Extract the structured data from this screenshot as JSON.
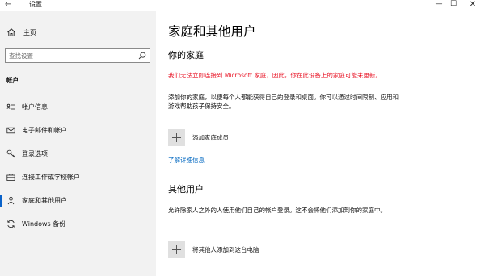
{
  "window": {
    "title": "设置",
    "back_glyph": "←",
    "minimize_glyph": "—",
    "maximize_glyph": "☐",
    "close_glyph": "✕"
  },
  "sidebar": {
    "home_label": "主页",
    "search_placeholder": "查找设置",
    "section_label": "帐户",
    "items": [
      {
        "label": "帐户信息",
        "icon": "account-info-icon",
        "active": false
      },
      {
        "label": "电子邮件和帐户",
        "icon": "mail-icon",
        "active": false
      },
      {
        "label": "登录选项",
        "icon": "key-icon",
        "active": false
      },
      {
        "label": "连接工作或学校帐户",
        "icon": "briefcase-icon",
        "active": false
      },
      {
        "label": "家庭和其他用户",
        "icon": "people-icon",
        "active": true
      },
      {
        "label": "Windows 备份",
        "icon": "sync-icon",
        "active": false
      }
    ]
  },
  "main": {
    "title": "家庭和其他用户",
    "family": {
      "heading": "你的家庭",
      "warning": "我们无法立即连接到 Microsoft 家庭，因此，你在此设备上的家庭可能未更新。",
      "description": "添加你的家庭，以便每个人都能获得自己的登录和桌面。你可以通过时间限制、应用和游戏帮助孩子保持安全。",
      "add_label": "添加家庭成员",
      "learn_more": "了解详细信息"
    },
    "others": {
      "heading": "其他用户",
      "description": "允许除家人之外的人使用他们自己的帐户登录。这不会将他们添加到你的家庭中。",
      "add_label": "将其他人添加到这台电脑"
    }
  },
  "colors": {
    "sidebar_bg": "#f2f2f2",
    "accent": "#0a62c9",
    "warning": "#e81123",
    "link": "#0067c0"
  }
}
